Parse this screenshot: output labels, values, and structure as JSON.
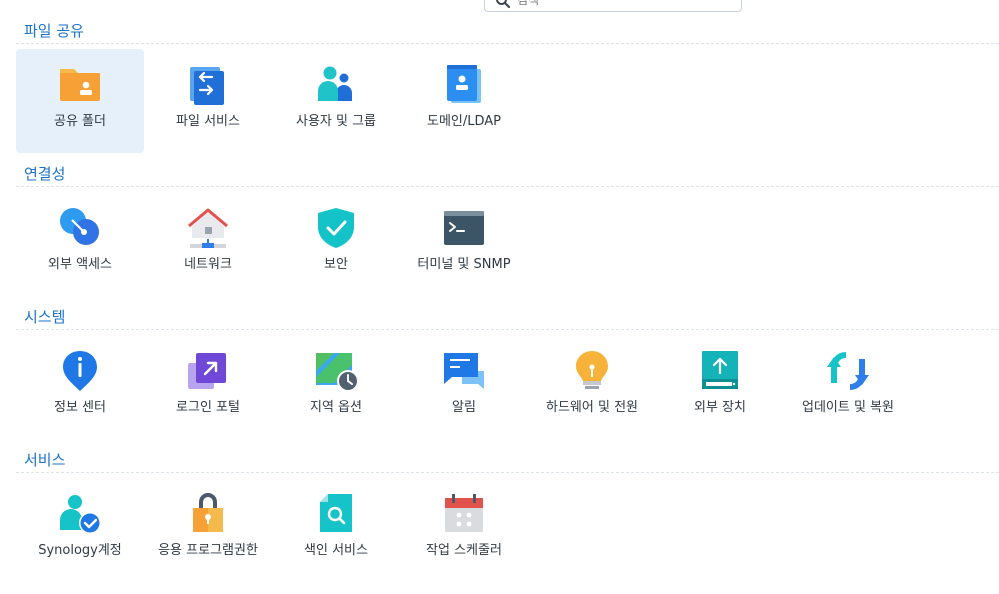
{
  "search": {
    "placeholder": "검색"
  },
  "sections": [
    {
      "title": "파일 공유",
      "items": [
        {
          "label": "공유 폴더",
          "icon": "shared-folder-icon",
          "selected": true
        },
        {
          "label": "파일 서비스",
          "icon": "file-services-icon"
        },
        {
          "label": "사용자 및 그룹",
          "icon": "user-group-icon"
        },
        {
          "label": "도메인/LDAP",
          "icon": "domain-ldap-icon"
        }
      ]
    },
    {
      "title": "연결성",
      "items": [
        {
          "label": "외부 액세스",
          "icon": "external-access-icon"
        },
        {
          "label": "네트워크",
          "icon": "network-icon"
        },
        {
          "label": "보안",
          "icon": "security-shield-icon"
        },
        {
          "label": "터미널 및 SNMP",
          "icon": "terminal-icon"
        }
      ]
    },
    {
      "title": "시스템",
      "items": [
        {
          "label": "정보 센터",
          "icon": "info-center-icon"
        },
        {
          "label": "로그인 포털",
          "icon": "login-portal-icon"
        },
        {
          "label": "지역 옵션",
          "icon": "regional-options-icon"
        },
        {
          "label": "알림",
          "icon": "notification-icon"
        },
        {
          "label": "하드웨어 및 전원",
          "icon": "hardware-power-icon"
        },
        {
          "label": "외부 장치",
          "icon": "external-devices-icon"
        },
        {
          "label": "업데이트 및 복원",
          "icon": "update-restore-icon"
        }
      ]
    },
    {
      "title": "서비스",
      "items": [
        {
          "label": "Synology계정",
          "icon": "synology-account-icon"
        },
        {
          "label": "응용 프로그램권한",
          "icon": "application-privileges-icon"
        },
        {
          "label": "색인 서비스",
          "icon": "indexing-service-icon"
        },
        {
          "label": "작업 스케줄러",
          "icon": "task-scheduler-icon"
        }
      ]
    }
  ]
}
